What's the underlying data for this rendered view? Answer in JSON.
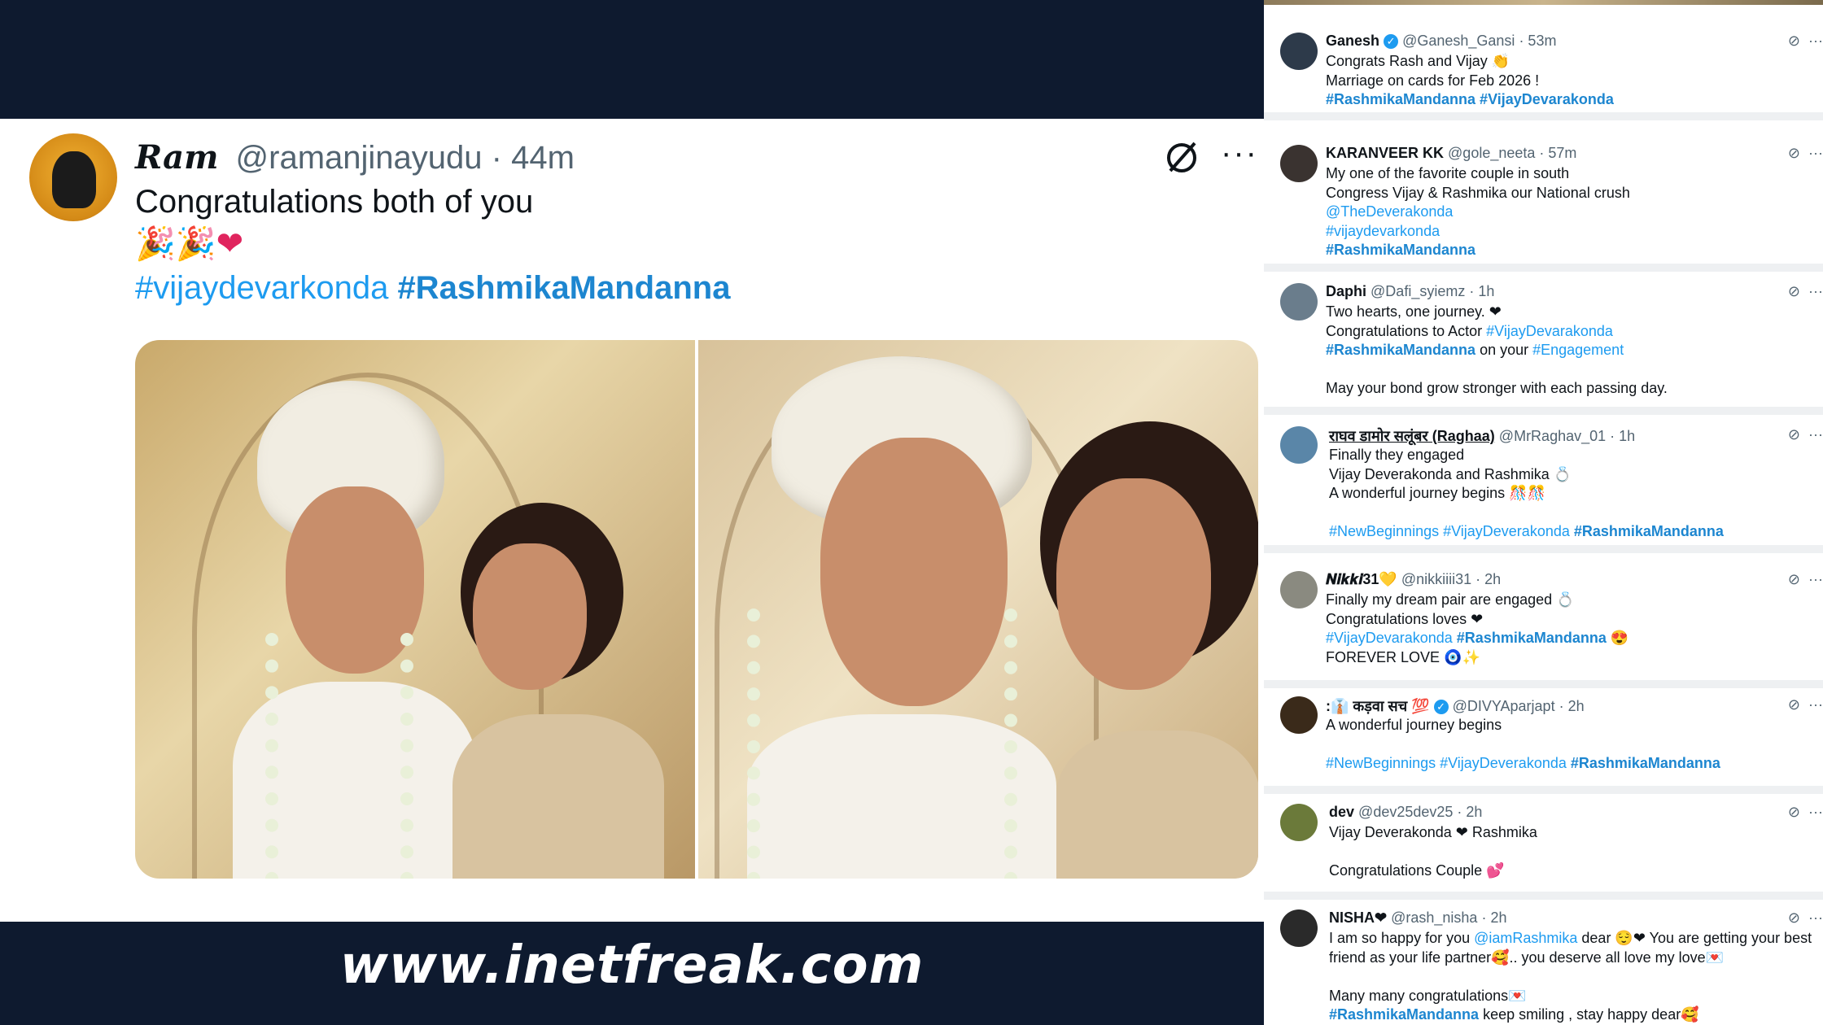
{
  "main_tweet": {
    "name": "Ram",
    "handle": "@ramanjinayudu",
    "time": "· 44m",
    "text": "Congratulations both of you",
    "emojis": "🎉🎉❤",
    "tag1": "#vijaydevarkonda",
    "tag2": "#RashmikaMandanna"
  },
  "watermark": "www.inetfreak.com",
  "replies": [
    {
      "name": "Ganesh",
      "verified": true,
      "handle": "@Ganesh_Gansi",
      "time": "· 53m",
      "lines": [
        "Congrats Rash and Vijay 👏",
        "Marriage on cards for Feb 2026 !"
      ],
      "tags": "#RashmikaMandanna #VijayDevarakonda"
    },
    {
      "name": "KARANVEER KK",
      "handle": "@gole_neeta",
      "time": "· 57m",
      "lines": [
        "My one of the favorite couple in south",
        "Congress Vijay & Rashmika our National crush"
      ],
      "link1": "@TheDeverakonda",
      "link2": "#vijaydevarkonda",
      "tags": "#RashmikaMandanna"
    },
    {
      "name": "Daphi",
      "handle": "@Dafi_syiemz",
      "time": "· 1h",
      "line1": "Two hearts, one journey. ❤",
      "line2_prefix": "Congratulations to Actor ",
      "line2_tag": "#VijayDevarakonda",
      "line3_tag": "#RashmikaMandanna",
      "line3_mid": " on your ",
      "line3_tag2": "#Engagement",
      "line4": "May your bond grow stronger with each passing day."
    },
    {
      "name": "राघव डामोर सलूंबर (Raghaa)",
      "handle": "@MrRaghav_01",
      "time": "· 1h",
      "lines": [
        "Finally they engaged",
        "Vijay Deverakonda and Rashmika 💍",
        "A wonderful journey begins 🎊🎊"
      ],
      "tags_plain": "#NewBeginnings #VijayDeverakonda",
      "tags_bold": "#RashmikaMandanna"
    },
    {
      "name": "𝑵𝒊𝒌𝒌𝒊31💛",
      "handle": "@nikkiiii31",
      "time": "· 2h",
      "lines": [
        "Finally my dream pair are engaged 💍",
        "Congratulations loves ❤"
      ],
      "tag_plain": "#VijayDevarakonda",
      "tag_bold": "#RashmikaMandanna",
      "tag_emoji": " 😍",
      "line_end": "FOREVER LOVE 🧿✨"
    },
    {
      "name": ":👔 कड़वा सच 💯",
      "verified": true,
      "handle": "@DIVYAparjapt",
      "time": "· 2h",
      "line1": "A wonderful journey begins",
      "tags_plain": "#NewBeginnings #VijayDeverakonda",
      "tags_bold": "#RashmikaMandanna"
    },
    {
      "name": "dev",
      "handle": "@dev25dev25",
      "time": "· 2h",
      "line1": "Vijay Deverakonda ❤ Rashmika",
      "line2": "Congratulations Couple 💕"
    },
    {
      "name": "NISHA❤",
      "handle": "@rash_nisha",
      "time": "· 2h",
      "line1_prefix": "I am so happy for you ",
      "line1_link": "@iamRashmika",
      "line1_suffix": " dear 😌❤ You are getting your best",
      "line2": "friend as your life partner🥰.. you deserve all love my love💌",
      "line3": "Many many congratulations💌",
      "line4_tag": "#RashmikaMandanna",
      "line4_suffix": " keep smiling , stay happy dear🥰"
    }
  ],
  "icons": {
    "grok": "grok-icon",
    "more": "more-icon"
  },
  "colors": {
    "navy": "#0e1a2f",
    "link": "#1d9bf0"
  }
}
